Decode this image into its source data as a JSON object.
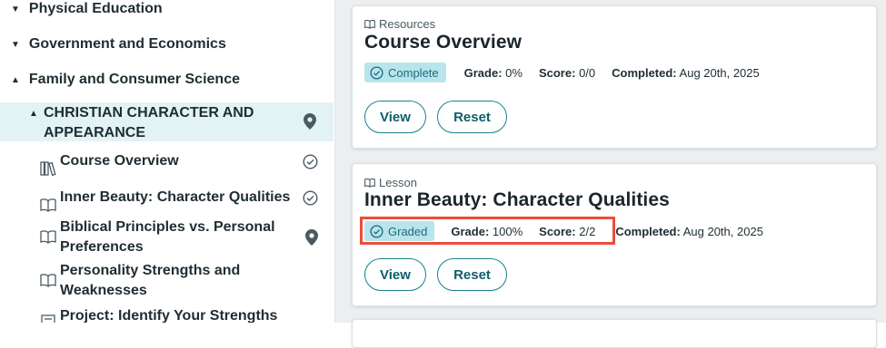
{
  "sidebar": {
    "categories": [
      {
        "label": "Physical Education",
        "state": "collapsed"
      },
      {
        "label": "Government and Economics",
        "state": "collapsed"
      },
      {
        "label": "Family and Consumer Science",
        "state": "expanded"
      }
    ],
    "unit": {
      "title": "CHRISTIAN CHARACTER AND APPEARANCE",
      "icon": "location-pin-icon"
    },
    "lessons": [
      {
        "label": "Course Overview",
        "icon": "books-icon",
        "status": "completed"
      },
      {
        "label": "Inner Beauty: Character Qualities",
        "icon": "open-book-icon",
        "status": "completed"
      },
      {
        "label": "Biblical Principles vs. Personal Preferences",
        "icon": "open-book-icon",
        "status": "current"
      },
      {
        "label": "Personality Strengths and Weaknesses",
        "icon": "open-book-icon",
        "status": ""
      },
      {
        "label": "Project: Identify Your Strengths and",
        "icon": "project-icon",
        "status": ""
      }
    ]
  },
  "cards": [
    {
      "kind": "Resources",
      "title": "Course Overview",
      "badge": "Complete",
      "grade_label": "Grade:",
      "grade_value": "0%",
      "score_label": "Score:",
      "score_value": "0/0",
      "completed_label": "Completed:",
      "completed_value": "Aug 20th, 2025",
      "view_label": "View",
      "reset_label": "Reset"
    },
    {
      "kind": "Lesson",
      "title": "Inner Beauty: Character Qualities",
      "badge": "Graded",
      "grade_label": "Grade:",
      "grade_value": "100%",
      "score_label": "Score:",
      "score_value": "2/2",
      "completed_label": "Completed:",
      "completed_value": "Aug 20th, 2025",
      "view_label": "View",
      "reset_label": "Reset"
    }
  ],
  "colors": {
    "accent": "#1a7f8e",
    "badge_bg": "#b9e4ec",
    "highlight": "#ee4b3c",
    "active_row": "#e3f3f5"
  }
}
